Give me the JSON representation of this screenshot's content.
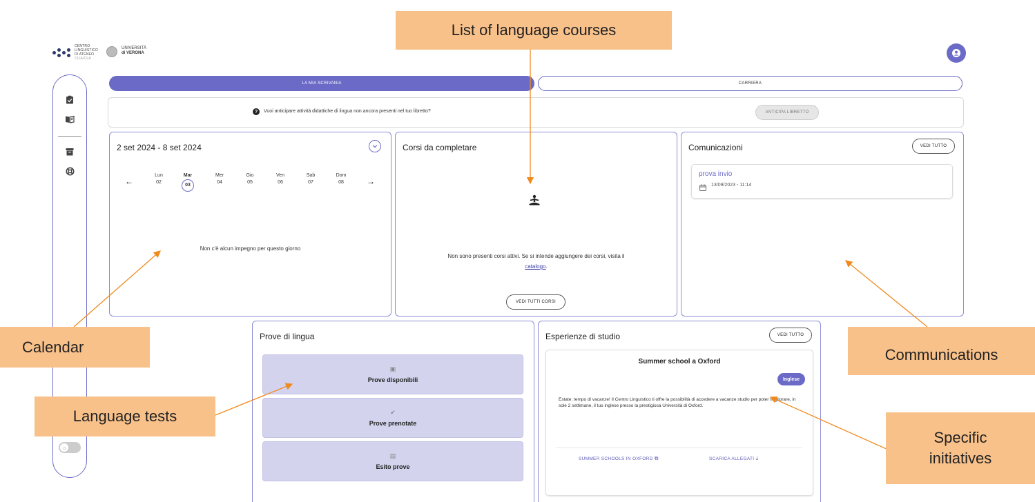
{
  "header": {
    "clia_logo_lines": [
      "CENTRO",
      "LINGUISTICO",
      "DI ATENEO",
      "CLIA/CLA"
    ],
    "univ_logo_lines": [
      "UNIVERSITÀ",
      "di VERONA"
    ]
  },
  "tabs": [
    {
      "label": "LA MIA SCRIVANIA",
      "active": true
    },
    {
      "label": "CARRIERA",
      "active": false
    }
  ],
  "info_bar": {
    "text": "Vuoi anticipare attività didattiche di lingua non ancora presenti nel tuo libretto?",
    "button": "ANTICIPA LIBRETTO"
  },
  "calendar": {
    "range": "2 set 2024 - 8 set 2024",
    "days": [
      {
        "name": "Lun",
        "num": "02"
      },
      {
        "name": "Mar",
        "num": "03",
        "selected": true
      },
      {
        "name": "Mer",
        "num": "04"
      },
      {
        "name": "Gio",
        "num": "05"
      },
      {
        "name": "Ven",
        "num": "06"
      },
      {
        "name": "Sab",
        "num": "07"
      },
      {
        "name": "Dom",
        "num": "08"
      }
    ],
    "empty": "Non c'è alcun impegno per questo giorno"
  },
  "courses": {
    "title": "Corsi da completare",
    "empty_line1": "Non sono presenti corsi attivi. Se si intende aggiungere dei corsi, visita il",
    "link": "catalogo",
    "after_link": ".",
    "button": "VEDI TUTTI CORSI"
  },
  "communications": {
    "title": "Comunicazioni",
    "button": "VEDI TUTTO",
    "items": [
      {
        "title": "prova invio",
        "date": "13/09/2023 - 11:14"
      }
    ]
  },
  "tests": {
    "title": "Prove di lingua",
    "items": [
      {
        "label": "Prove disponibili",
        "icon": "wallet-icon"
      },
      {
        "label": "Prove prenotate",
        "icon": "check-icon"
      },
      {
        "label": "Esito prove",
        "icon": "list-icon"
      }
    ]
  },
  "experiences": {
    "title": "Esperienze di studio",
    "button": "VEDI TUTTO",
    "card": {
      "title": "Summer school a Oxford",
      "badge": "Inglese",
      "description": "Estate: tempo di vacanze! Il Centro Linguistico ti offre la possibilità di accedere a vacanze studio per poter migliorare, in sole 2 settimane, il tuo inglese presso la prestigiosa Università di Oxford.",
      "link1": "SUMMER SCHOOLS IN OXFORD",
      "link2": "SCARICA ALLEGATI"
    }
  },
  "annotations": {
    "list_courses": "List of language courses",
    "calendar": "Calendar",
    "communications": "Communications",
    "language_tests": "Language tests",
    "specific_line1": "Specific",
    "specific_line2": "initiatives"
  },
  "colors": {
    "accent": "#6b6bc7",
    "tile": "#d3d3ee",
    "callout": "#f9c18a",
    "arrow": "#f08a1c"
  }
}
